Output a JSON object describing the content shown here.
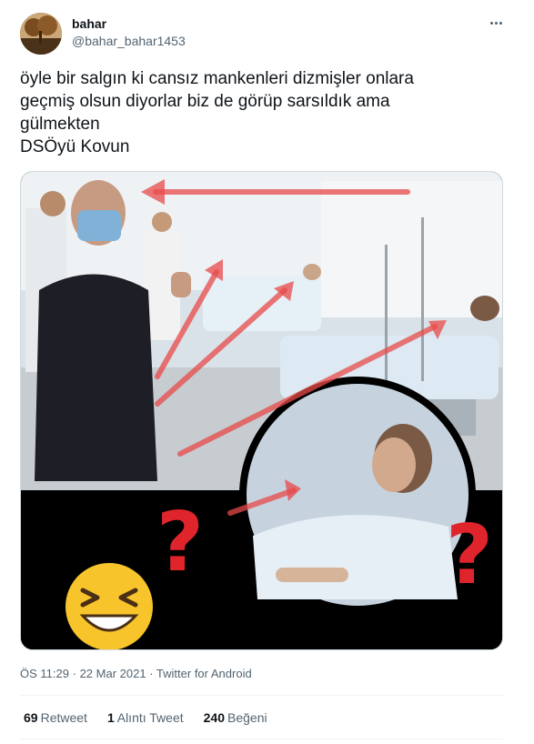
{
  "user": {
    "display_name": "bahar",
    "handle": "@bahar_bahar1453"
  },
  "tweet": {
    "lines": [
      "öyle bir salgın ki cansız mankenleri dizmişler onlara",
      "geçmiş olsun diyorlar biz de görüp sarsıldık ama",
      "gülmekten",
      "DSÖyü Kovun"
    ]
  },
  "meta": {
    "time": "ÖS 11:29",
    "separator": "·",
    "date": "22 Mar 2021",
    "source": "Twitter for Android"
  },
  "stats": {
    "retweets_count": "69",
    "retweets_label": "Retweet",
    "quotes_count": "1",
    "quotes_label": "Alıntı Tweet",
    "likes_count": "240",
    "likes_label": "Beğeni"
  },
  "icons": {
    "more": "more-horizontal-icon",
    "emoji": "laughing-emoji",
    "question": "question-mark"
  },
  "colors": {
    "text": "#0f1419",
    "secondary": "#536471",
    "arrow": "#e84a4a",
    "question": "#e0242b",
    "emoji": "#f7c52b"
  }
}
